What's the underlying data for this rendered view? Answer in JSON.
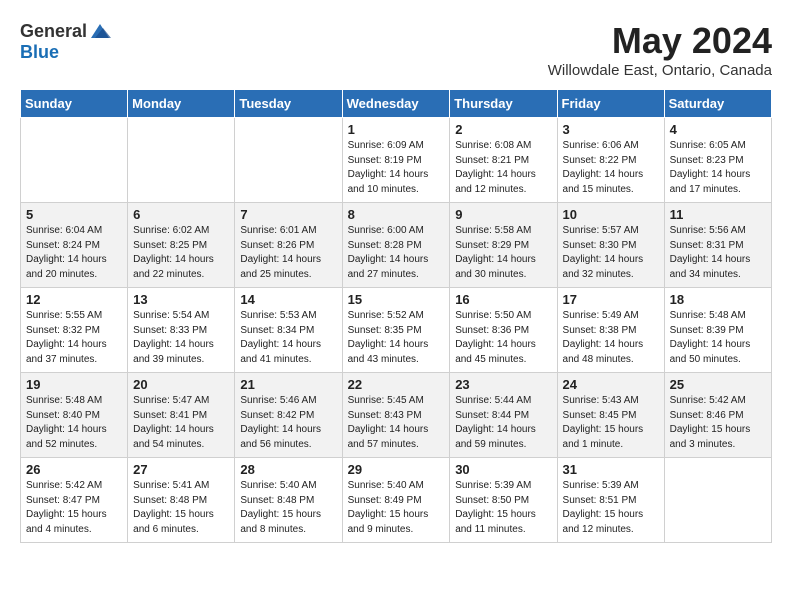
{
  "header": {
    "logo_general": "General",
    "logo_blue": "Blue",
    "month": "May 2024",
    "location": "Willowdale East, Ontario, Canada"
  },
  "weekdays": [
    "Sunday",
    "Monday",
    "Tuesday",
    "Wednesday",
    "Thursday",
    "Friday",
    "Saturday"
  ],
  "weeks": [
    [
      {
        "day": "",
        "info": ""
      },
      {
        "day": "",
        "info": ""
      },
      {
        "day": "",
        "info": ""
      },
      {
        "day": "1",
        "info": "Sunrise: 6:09 AM\nSunset: 8:19 PM\nDaylight: 14 hours\nand 10 minutes."
      },
      {
        "day": "2",
        "info": "Sunrise: 6:08 AM\nSunset: 8:21 PM\nDaylight: 14 hours\nand 12 minutes."
      },
      {
        "day": "3",
        "info": "Sunrise: 6:06 AM\nSunset: 8:22 PM\nDaylight: 14 hours\nand 15 minutes."
      },
      {
        "day": "4",
        "info": "Sunrise: 6:05 AM\nSunset: 8:23 PM\nDaylight: 14 hours\nand 17 minutes."
      }
    ],
    [
      {
        "day": "5",
        "info": "Sunrise: 6:04 AM\nSunset: 8:24 PM\nDaylight: 14 hours\nand 20 minutes."
      },
      {
        "day": "6",
        "info": "Sunrise: 6:02 AM\nSunset: 8:25 PM\nDaylight: 14 hours\nand 22 minutes."
      },
      {
        "day": "7",
        "info": "Sunrise: 6:01 AM\nSunset: 8:26 PM\nDaylight: 14 hours\nand 25 minutes."
      },
      {
        "day": "8",
        "info": "Sunrise: 6:00 AM\nSunset: 8:28 PM\nDaylight: 14 hours\nand 27 minutes."
      },
      {
        "day": "9",
        "info": "Sunrise: 5:58 AM\nSunset: 8:29 PM\nDaylight: 14 hours\nand 30 minutes."
      },
      {
        "day": "10",
        "info": "Sunrise: 5:57 AM\nSunset: 8:30 PM\nDaylight: 14 hours\nand 32 minutes."
      },
      {
        "day": "11",
        "info": "Sunrise: 5:56 AM\nSunset: 8:31 PM\nDaylight: 14 hours\nand 34 minutes."
      }
    ],
    [
      {
        "day": "12",
        "info": "Sunrise: 5:55 AM\nSunset: 8:32 PM\nDaylight: 14 hours\nand 37 minutes."
      },
      {
        "day": "13",
        "info": "Sunrise: 5:54 AM\nSunset: 8:33 PM\nDaylight: 14 hours\nand 39 minutes."
      },
      {
        "day": "14",
        "info": "Sunrise: 5:53 AM\nSunset: 8:34 PM\nDaylight: 14 hours\nand 41 minutes."
      },
      {
        "day": "15",
        "info": "Sunrise: 5:52 AM\nSunset: 8:35 PM\nDaylight: 14 hours\nand 43 minutes."
      },
      {
        "day": "16",
        "info": "Sunrise: 5:50 AM\nSunset: 8:36 PM\nDaylight: 14 hours\nand 45 minutes."
      },
      {
        "day": "17",
        "info": "Sunrise: 5:49 AM\nSunset: 8:38 PM\nDaylight: 14 hours\nand 48 minutes."
      },
      {
        "day": "18",
        "info": "Sunrise: 5:48 AM\nSunset: 8:39 PM\nDaylight: 14 hours\nand 50 minutes."
      }
    ],
    [
      {
        "day": "19",
        "info": "Sunrise: 5:48 AM\nSunset: 8:40 PM\nDaylight: 14 hours\nand 52 minutes."
      },
      {
        "day": "20",
        "info": "Sunrise: 5:47 AM\nSunset: 8:41 PM\nDaylight: 14 hours\nand 54 minutes."
      },
      {
        "day": "21",
        "info": "Sunrise: 5:46 AM\nSunset: 8:42 PM\nDaylight: 14 hours\nand 56 minutes."
      },
      {
        "day": "22",
        "info": "Sunrise: 5:45 AM\nSunset: 8:43 PM\nDaylight: 14 hours\nand 57 minutes."
      },
      {
        "day": "23",
        "info": "Sunrise: 5:44 AM\nSunset: 8:44 PM\nDaylight: 14 hours\nand 59 minutes."
      },
      {
        "day": "24",
        "info": "Sunrise: 5:43 AM\nSunset: 8:45 PM\nDaylight: 15 hours\nand 1 minute."
      },
      {
        "day": "25",
        "info": "Sunrise: 5:42 AM\nSunset: 8:46 PM\nDaylight: 15 hours\nand 3 minutes."
      }
    ],
    [
      {
        "day": "26",
        "info": "Sunrise: 5:42 AM\nSunset: 8:47 PM\nDaylight: 15 hours\nand 4 minutes."
      },
      {
        "day": "27",
        "info": "Sunrise: 5:41 AM\nSunset: 8:48 PM\nDaylight: 15 hours\nand 6 minutes."
      },
      {
        "day": "28",
        "info": "Sunrise: 5:40 AM\nSunset: 8:48 PM\nDaylight: 15 hours\nand 8 minutes."
      },
      {
        "day": "29",
        "info": "Sunrise: 5:40 AM\nSunset: 8:49 PM\nDaylight: 15 hours\nand 9 minutes."
      },
      {
        "day": "30",
        "info": "Sunrise: 5:39 AM\nSunset: 8:50 PM\nDaylight: 15 hours\nand 11 minutes."
      },
      {
        "day": "31",
        "info": "Sunrise: 5:39 AM\nSunset: 8:51 PM\nDaylight: 15 hours\nand 12 minutes."
      },
      {
        "day": "",
        "info": ""
      }
    ]
  ]
}
